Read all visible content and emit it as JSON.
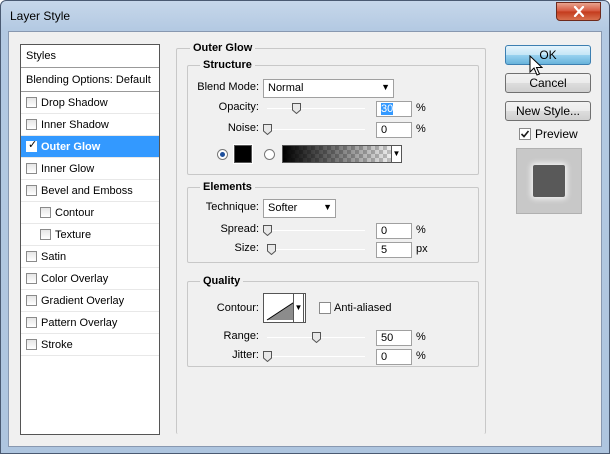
{
  "window": {
    "title": "Layer Style"
  },
  "styles_panel": {
    "header": "Styles",
    "blending_options": "Blending Options: Default",
    "items": [
      {
        "label": "Drop Shadow",
        "checked": false,
        "selected": false,
        "sub": false
      },
      {
        "label": "Inner Shadow",
        "checked": false,
        "selected": false,
        "sub": false
      },
      {
        "label": "Outer Glow",
        "checked": true,
        "selected": true,
        "sub": false
      },
      {
        "label": "Inner Glow",
        "checked": false,
        "selected": false,
        "sub": false
      },
      {
        "label": "Bevel and Emboss",
        "checked": false,
        "selected": false,
        "sub": false
      },
      {
        "label": "Contour",
        "checked": false,
        "selected": false,
        "sub": true
      },
      {
        "label": "Texture",
        "checked": false,
        "selected": false,
        "sub": true
      },
      {
        "label": "Satin",
        "checked": false,
        "selected": false,
        "sub": false
      },
      {
        "label": "Color Overlay",
        "checked": false,
        "selected": false,
        "sub": false
      },
      {
        "label": "Gradient Overlay",
        "checked": false,
        "selected": false,
        "sub": false
      },
      {
        "label": "Pattern Overlay",
        "checked": false,
        "selected": false,
        "sub": false
      },
      {
        "label": "Stroke",
        "checked": false,
        "selected": false,
        "sub": false
      }
    ]
  },
  "outer_glow": {
    "title": "Outer Glow",
    "structure": {
      "title": "Structure",
      "blend_mode_label": "Blend Mode:",
      "blend_mode_value": "Normal",
      "opacity_label": "Opacity:",
      "opacity_value": "30",
      "opacity_unit": "%",
      "noise_label": "Noise:",
      "noise_value": "0",
      "noise_unit": "%"
    },
    "elements": {
      "title": "Elements",
      "technique_label": "Technique:",
      "technique_value": "Softer",
      "spread_label": "Spread:",
      "spread_value": "0",
      "spread_unit": "%",
      "size_label": "Size:",
      "size_value": "5",
      "size_unit": "px"
    },
    "quality": {
      "title": "Quality",
      "contour_label": "Contour:",
      "anti_aliased_label": "Anti-aliased",
      "range_label": "Range:",
      "range_value": "50",
      "range_unit": "%",
      "jitter_label": "Jitter:",
      "jitter_value": "0",
      "jitter_unit": "%"
    }
  },
  "buttons": {
    "ok": "OK",
    "cancel": "Cancel",
    "new_style": "New Style...",
    "preview_label": "Preview"
  },
  "colors": {
    "selection": "#3399ff",
    "glow_color": "#000000",
    "preview_square": "#595959"
  },
  "icons": {
    "close": "close-icon",
    "dropdown": "chevron-down-icon",
    "checkbox": "check-icon",
    "cursor": "arrow-cursor-icon"
  }
}
